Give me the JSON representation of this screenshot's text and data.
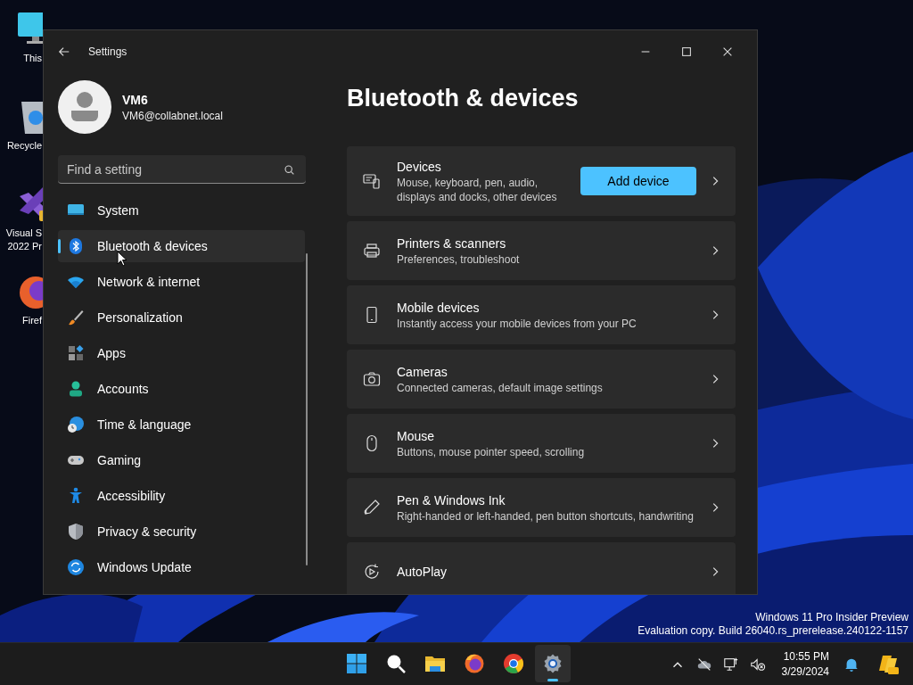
{
  "desktop_icons": [
    {
      "kind": "monitor",
      "lines": [
        "This"
      ]
    },
    {
      "kind": "recycle",
      "lines": [
        "Recycle"
      ]
    },
    {
      "kind": "studio",
      "lines": [
        "Visual S",
        "2022 Pr"
      ]
    },
    {
      "kind": "firefox",
      "lines": [
        "Firef"
      ]
    }
  ],
  "window": {
    "title": "Settings",
    "account": {
      "name": "VM6",
      "email": "VM6@collabnet.local"
    },
    "search": {
      "placeholder": "Find a setting"
    },
    "nav": [
      {
        "kind": "system",
        "label": "System",
        "selected": false
      },
      {
        "kind": "bluetooth",
        "label": "Bluetooth & devices",
        "selected": true
      },
      {
        "kind": "network",
        "label": "Network & internet",
        "selected": false
      },
      {
        "kind": "brush",
        "label": "Personalization",
        "selected": false
      },
      {
        "kind": "apps",
        "label": "Apps",
        "selected": false
      },
      {
        "kind": "accounts",
        "label": "Accounts",
        "selected": false
      },
      {
        "kind": "time",
        "label": "Time & language",
        "selected": false
      },
      {
        "kind": "gaming",
        "label": "Gaming",
        "selected": false
      },
      {
        "kind": "accessibility",
        "label": "Accessibility",
        "selected": false
      },
      {
        "kind": "privacy",
        "label": "Privacy & security",
        "selected": false
      },
      {
        "kind": "update",
        "label": "Windows Update",
        "selected": false
      }
    ],
    "page_title": "Bluetooth & devices",
    "cards": [
      {
        "kind": "keyboard",
        "title": "Devices",
        "subtitle": [
          "Mouse, keyboard, pen, audio,",
          "displays and docks, other devices"
        ],
        "button": "Add device"
      },
      {
        "kind": "printer",
        "title": "Printers & scanners",
        "subtitle": [
          "Preferences, troubleshoot"
        ]
      },
      {
        "kind": "phone",
        "title": "Mobile devices",
        "subtitle": [
          "Instantly access your mobile devices from your PC"
        ]
      },
      {
        "kind": "camera",
        "title": "Cameras",
        "subtitle": [
          "Connected cameras, default image settings"
        ]
      },
      {
        "kind": "mouse",
        "title": "Mouse",
        "subtitle": [
          "Buttons, mouse pointer speed, scrolling"
        ]
      },
      {
        "kind": "pen",
        "title": "Pen & Windows Ink",
        "subtitle": [
          "Right-handed or left-handed, pen button shortcuts, handwriting"
        ]
      },
      {
        "kind": "autoplay",
        "title": "AutoPlay"
      }
    ]
  },
  "build_notice": [
    "Windows 11 Pro Insider Preview",
    "Evaluation copy. Build 26040.rs_prerelease.240122-1157"
  ],
  "taskbar": {
    "apps": [
      {
        "kind": "start",
        "selected": false
      },
      {
        "kind": "search",
        "selected": false
      },
      {
        "kind": "explorer",
        "selected": false
      },
      {
        "kind": "firefox",
        "selected": false
      },
      {
        "kind": "chrome",
        "selected": false
      },
      {
        "kind": "settings",
        "selected": true
      }
    ],
    "tray": [
      {
        "kind": "chevron"
      },
      {
        "kind": "cloud"
      },
      {
        "kind": "network"
      },
      {
        "kind": "volume"
      }
    ],
    "clock": {
      "time": "10:55 PM",
      "date": "3/29/2024"
    }
  }
}
